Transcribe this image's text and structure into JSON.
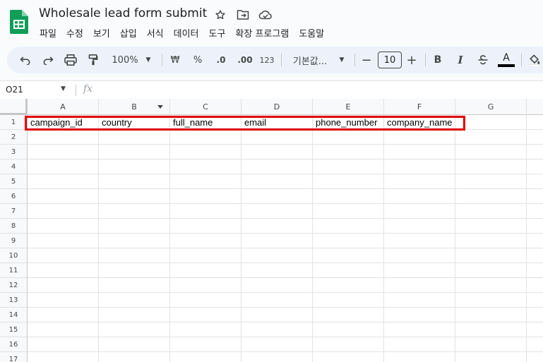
{
  "app": {
    "title": "Wholesale lead form submit",
    "brand_color": "#0f9d58"
  },
  "menubar": {
    "items": [
      "파일",
      "수정",
      "보기",
      "삽입",
      "서식",
      "데이터",
      "도구",
      "확장 프로그램",
      "도움말"
    ]
  },
  "toolbar": {
    "zoom": "100%",
    "currency": "₩",
    "percent": "%",
    "decrease_decimal": ".0",
    "increase_decimal": ".00",
    "number_format": "123",
    "font_family": "기본값...",
    "font_size": "10",
    "bold": "B",
    "italic": "I",
    "text_color": "A"
  },
  "formula_bar": {
    "name_box": "O21",
    "fx_label": "fx"
  },
  "sheet": {
    "columns": [
      "A",
      "B",
      "C",
      "D",
      "E",
      "F",
      "G"
    ],
    "rows": [
      "1",
      "2",
      "3",
      "4",
      "5",
      "6",
      "7",
      "8",
      "9",
      "10",
      "11",
      "12",
      "13",
      "14",
      "15",
      "16",
      "17"
    ],
    "row1": [
      "campaign_id",
      "country",
      "full_name",
      "email",
      "phone_number",
      "company_name",
      ""
    ]
  },
  "highlight_color": "#e00000"
}
